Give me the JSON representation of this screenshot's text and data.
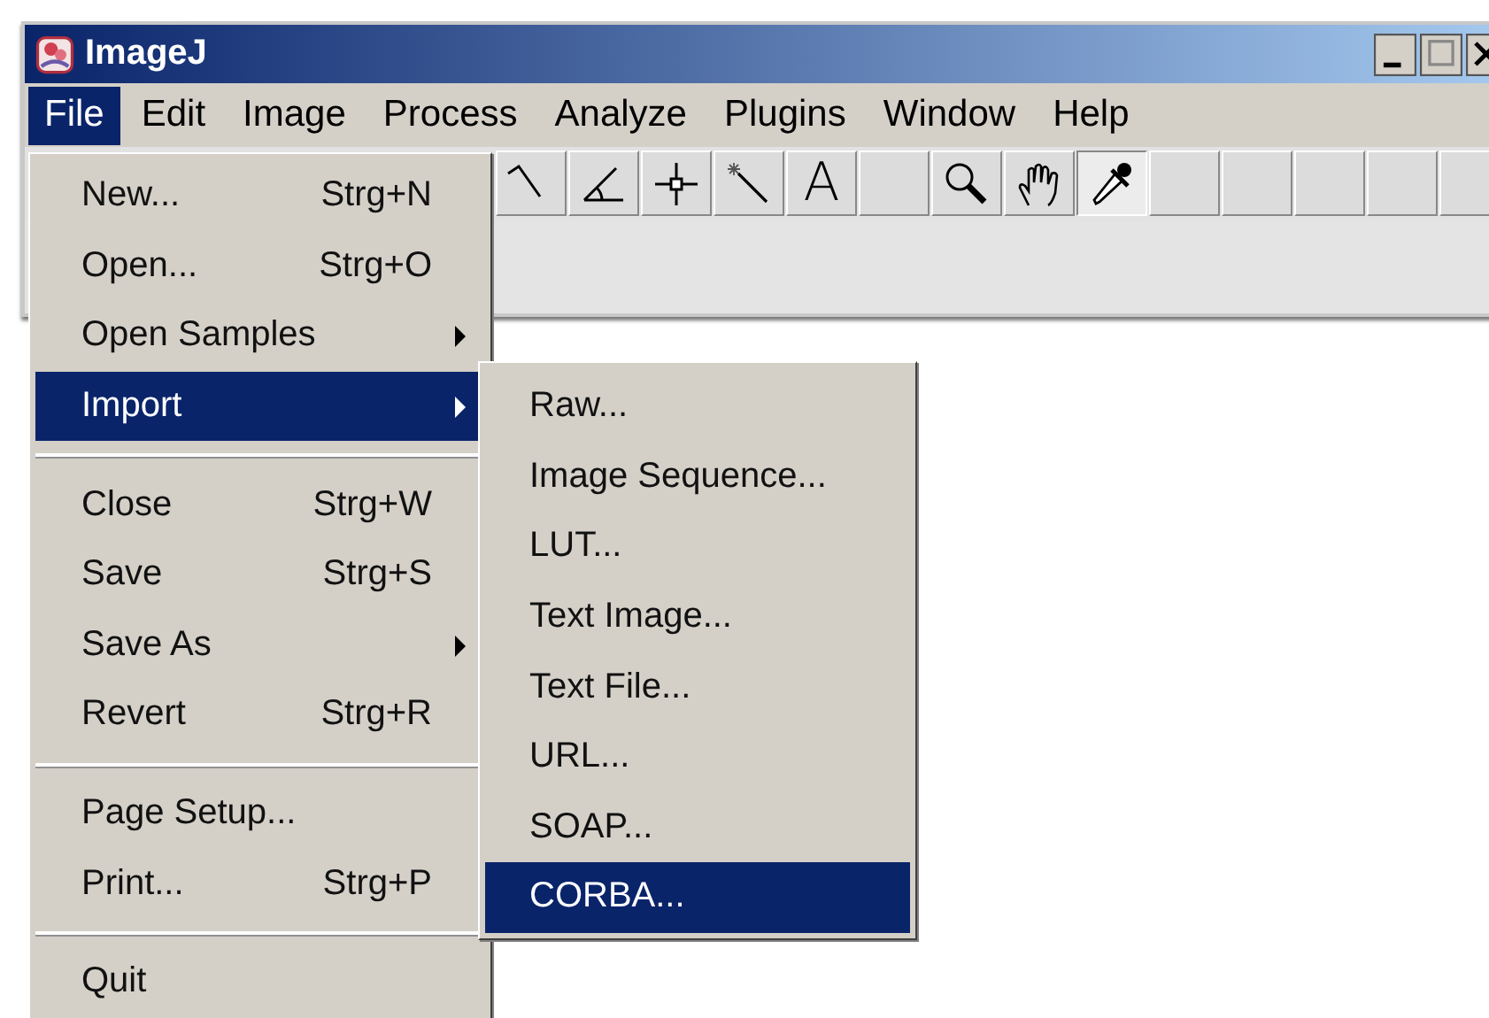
{
  "window": {
    "title": "ImageJ"
  },
  "menubar": [
    {
      "label": "File",
      "selected": true
    },
    {
      "label": "Edit",
      "selected": false
    },
    {
      "label": "Image",
      "selected": false
    },
    {
      "label": "Process",
      "selected": false
    },
    {
      "label": "Analyze",
      "selected": false
    },
    {
      "label": "Plugins",
      "selected": false
    },
    {
      "label": "Window",
      "selected": false
    },
    {
      "label": "Help",
      "selected": false
    }
  ],
  "toolbar": [
    {
      "kind": "polyline",
      "selected": false
    },
    {
      "kind": "angle",
      "selected": false
    },
    {
      "kind": "point",
      "selected": false
    },
    {
      "kind": "wand",
      "selected": false
    },
    {
      "kind": "text",
      "label": "A",
      "selected": false
    },
    {
      "kind": "blank",
      "selected": false
    },
    {
      "kind": "zoom",
      "selected": false
    },
    {
      "kind": "hand",
      "selected": false
    },
    {
      "kind": "dropper",
      "selected": true
    },
    {
      "kind": "blank",
      "selected": false
    },
    {
      "kind": "blank",
      "selected": false
    },
    {
      "kind": "blank",
      "selected": false
    },
    {
      "kind": "blank",
      "selected": false
    },
    {
      "kind": "blank",
      "selected": false
    }
  ],
  "file_menu": [
    {
      "kind": "item",
      "label": "New...",
      "shortcut": "Strg+N",
      "submenu": false,
      "selected": false
    },
    {
      "kind": "item",
      "label": "Open...",
      "shortcut": "Strg+O",
      "submenu": false,
      "selected": false
    },
    {
      "kind": "item",
      "label": "Open Samples",
      "submenu": true,
      "selected": false
    },
    {
      "kind": "item",
      "label": "Import",
      "submenu": true,
      "selected": true
    },
    {
      "kind": "separator"
    },
    {
      "kind": "item",
      "label": "Close",
      "shortcut": "Strg+W",
      "submenu": false,
      "selected": false
    },
    {
      "kind": "item",
      "label": "Save",
      "shortcut": "Strg+S",
      "submenu": false,
      "selected": false
    },
    {
      "kind": "item",
      "label": "Save As",
      "submenu": true,
      "selected": false
    },
    {
      "kind": "item",
      "label": "Revert",
      "shortcut": "Strg+R",
      "submenu": false,
      "selected": false
    },
    {
      "kind": "separator"
    },
    {
      "kind": "item",
      "label": "Page Setup...",
      "submenu": false,
      "selected": false
    },
    {
      "kind": "item",
      "label": "Print...",
      "shortcut": "Strg+P",
      "submenu": false,
      "selected": false
    },
    {
      "kind": "separator"
    },
    {
      "kind": "item",
      "label": "Quit",
      "submenu": false,
      "selected": false
    }
  ],
  "import_menu": [
    {
      "label": "Raw...",
      "selected": false
    },
    {
      "label": "Image Sequence...",
      "selected": false
    },
    {
      "label": "LUT...",
      "selected": false
    },
    {
      "label": "Text Image...",
      "selected": false
    },
    {
      "label": "Text File...",
      "selected": false
    },
    {
      "label": "URL...",
      "selected": false
    },
    {
      "label": "SOAP...",
      "selected": false
    },
    {
      "label": "CORBA...",
      "selected": true
    }
  ]
}
